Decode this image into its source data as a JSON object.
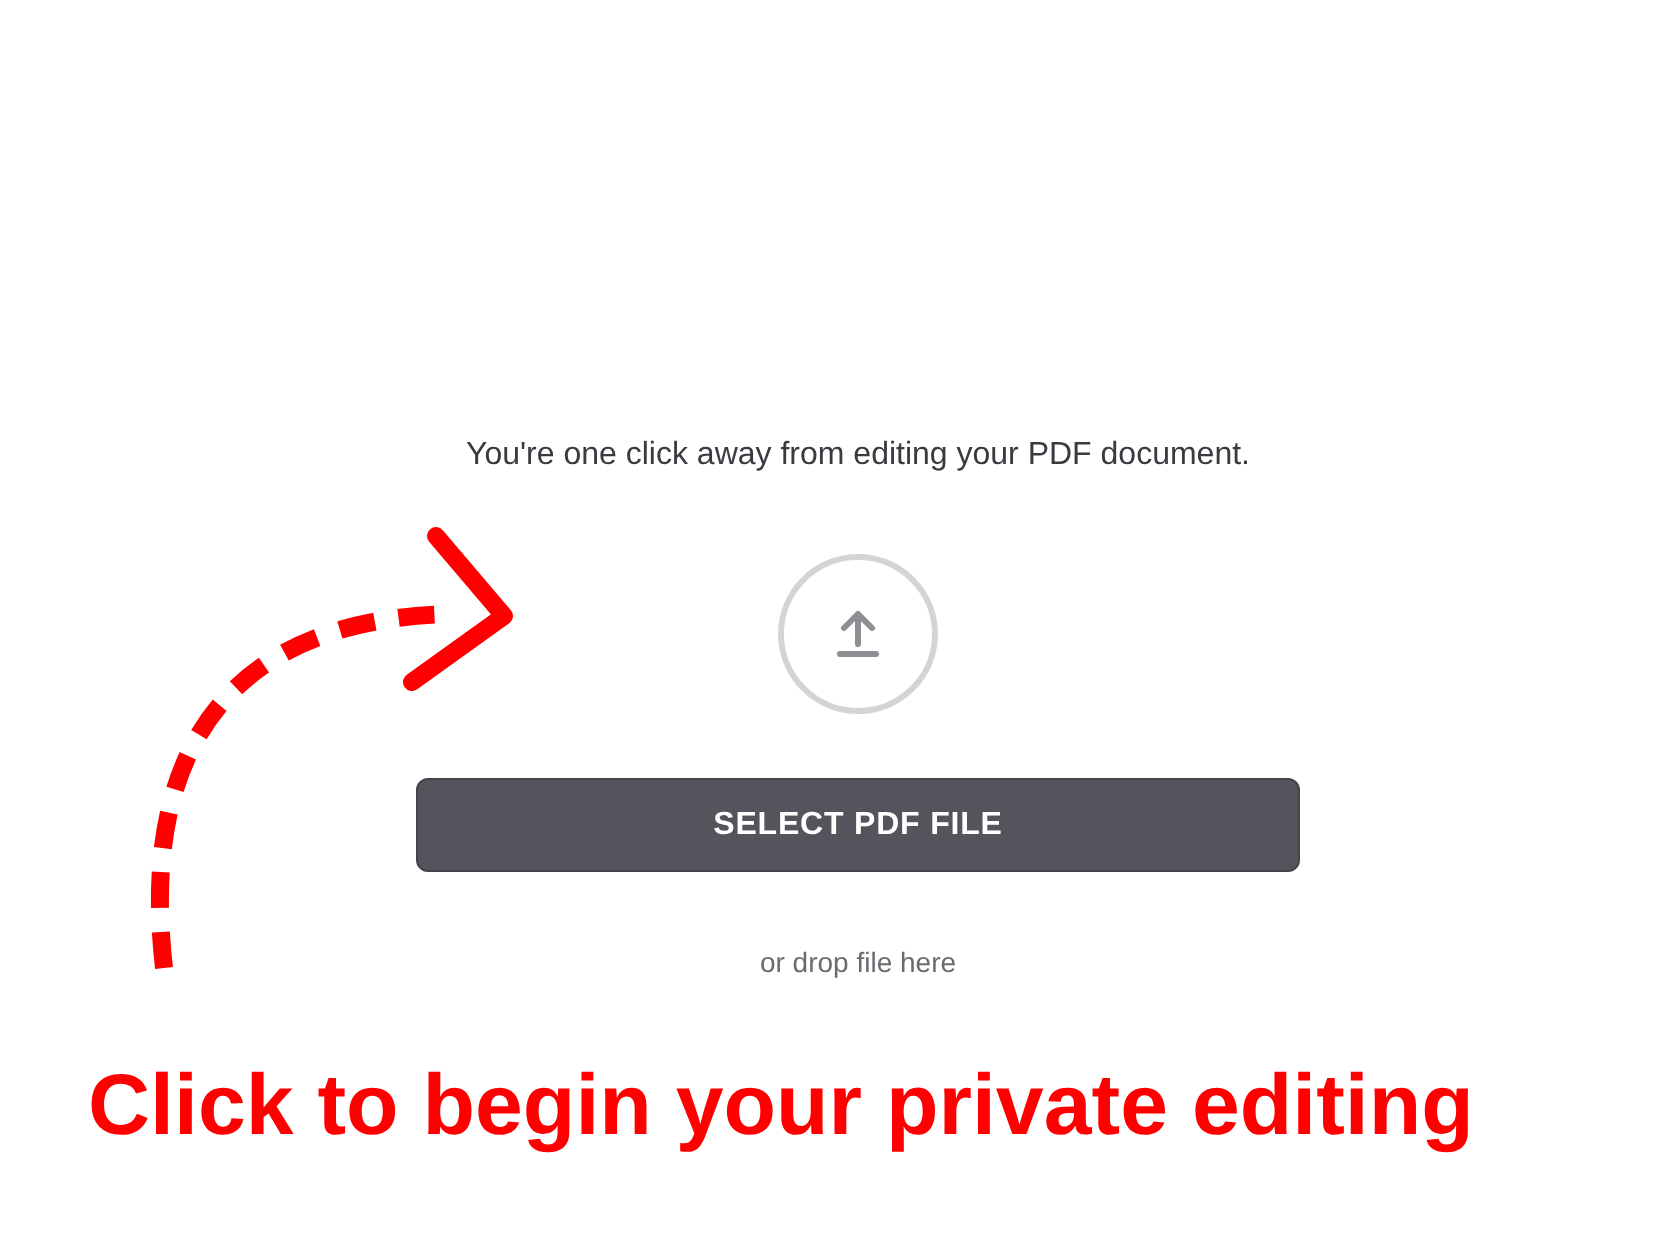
{
  "prompt": "You're one click away from editing your PDF document.",
  "upload_button": {
    "label": "SELECT PDF FILE"
  },
  "drop_hint": "or drop file here",
  "annotation": {
    "text": "Click to begin your private editing",
    "color": "#ff0000"
  }
}
